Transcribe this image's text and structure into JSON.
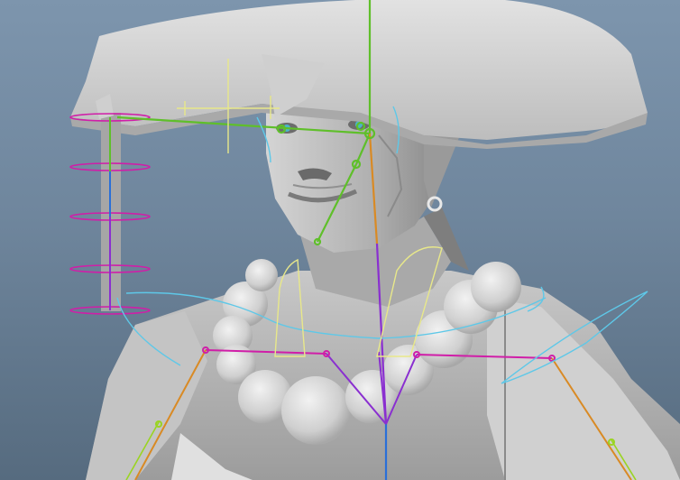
{
  "viewport": {
    "background_top": "#7d95ad",
    "background_bottom": "#566b7f"
  },
  "colors": {
    "mesh": "#b8b8b8",
    "mesh_light": "#d6d6d6",
    "mesh_shadow": "#6e6e6e",
    "joint_magenta": "#d01ea8",
    "joint_green": "#5fbf2a",
    "joint_blue": "#2a6fd8",
    "joint_purple": "#8a2fd0",
    "joint_orange": "#d98a24",
    "curve_cyan": "#5ec8e8",
    "locator_yellow": "#e8e88a",
    "control_lime": "#9ad421"
  },
  "icons": [
    "character-mesh",
    "joint-chain",
    "nurbs-control-curve",
    "locator"
  ]
}
